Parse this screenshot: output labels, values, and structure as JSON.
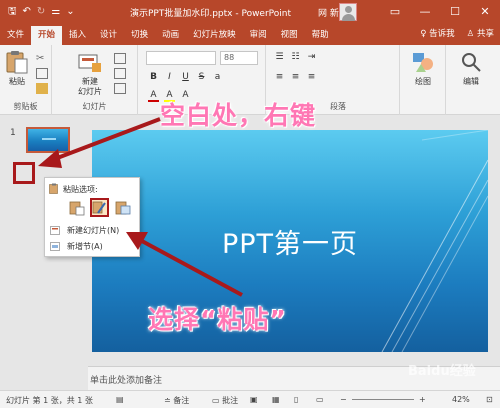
{
  "window": {
    "title": "演示PPT批量加水印.pptx  -  PowerPoint",
    "user": "网 新",
    "controls": [
      "▭",
      "—",
      "☐",
      "✕"
    ]
  },
  "ribbon_tabs": [
    "文件",
    "开始",
    "插入",
    "设计",
    "切换",
    "动画",
    "幻灯片放映",
    "审阅",
    "视图",
    "帮助"
  ],
  "active_tab": "开始",
  "tell_me": "告诉我",
  "share": "共享",
  "ribbon": {
    "paste_label": "粘贴",
    "clipboard_group": "剪贴板",
    "new_slide_label": "新建\n幻灯片",
    "slides_group": "幻灯片",
    "font_size": "88",
    "paragraph_group": "段落",
    "drawing_label": "绘图",
    "editing_label": "编辑"
  },
  "slide_panel": {
    "slide_number": "1"
  },
  "slide": {
    "title": "PPT第一页"
  },
  "context_menu": {
    "header": "粘贴选项:",
    "items": [
      "新建幻灯片(N)",
      "新增节(A)"
    ]
  },
  "notes_placeholder": "单击此处添加备注",
  "statusbar": {
    "slide_info": "幻灯片 第 1 张，共 1 张",
    "notes": "备注",
    "comments": "批注",
    "zoom": "42%"
  },
  "annotations": {
    "top": "空白处，右键",
    "bottom": "选择“粘贴”"
  },
  "watermark": "Baidu经验",
  "colors": {
    "accent": "#b7472a",
    "annotation": "#ff77b4",
    "highlight_box": "#a8191b"
  }
}
